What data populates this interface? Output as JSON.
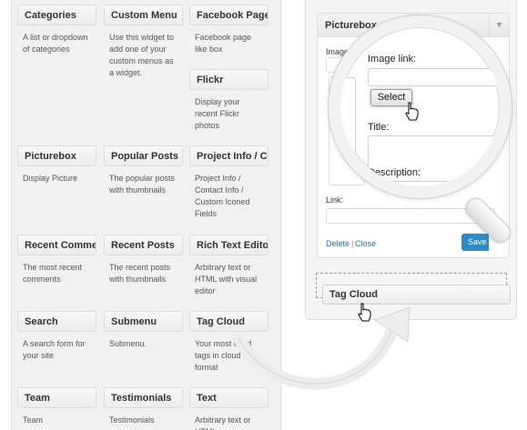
{
  "widgets": [
    {
      "title": "Categories",
      "desc": "A list or dropdown of categories"
    },
    {
      "title": "Custom Menu",
      "desc": "Use this widget to add one of your custom menus as a widget."
    },
    {
      "title": "Facebook Page",
      "desc": "Facebook page like box"
    },
    {
      "title": "Flickr",
      "desc": "Display your recent Flickr photos"
    },
    {
      "title": "Picturebox",
      "desc": "Display Picture"
    },
    {
      "title": "Popular Posts",
      "desc": "The popular posts with thumbnails"
    },
    {
      "title": "Project Info / Contact Info",
      "desc": "Project Info / Contact Info / Custom Iconed Fields"
    },
    {
      "title": "Recent Comments",
      "desc": "The most recent comments"
    },
    {
      "title": "Recent Posts",
      "desc": "The recent posts with thumbnails"
    },
    {
      "title": "Rich Text Editor",
      "desc": "Arbitrary text or HTML with visual editor"
    },
    {
      "title": "Search",
      "desc": "A search form for your site"
    },
    {
      "title": "Submenu",
      "desc": "Submenu."
    },
    {
      "title": "Tag Cloud",
      "desc": "Your most used tags in cloud format"
    },
    {
      "title": "Team",
      "desc": "Team"
    },
    {
      "title": "Testimonials",
      "desc": "Testimonials"
    },
    {
      "title": "Text",
      "desc": "Arbitrary text or HTML"
    }
  ],
  "picturebox": {
    "title": "Picturebox",
    "image_link_label": "Image link:",
    "link_label": "Link:",
    "delete": "Delete",
    "separator": "|",
    "close": "Close",
    "save": "Save"
  },
  "zoom": {
    "image_link_label": "Image link:",
    "select_button": "Select",
    "title_label": "Title:",
    "description_label": "Description:"
  },
  "dragging": {
    "title": "Tag Cloud"
  }
}
